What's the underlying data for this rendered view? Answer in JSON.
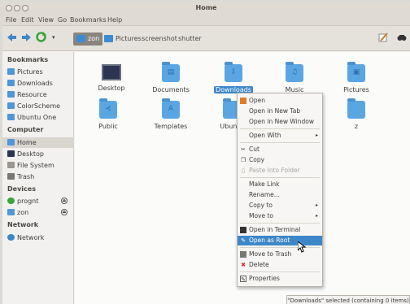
{
  "window": {
    "title": "Home"
  },
  "menubar": [
    "File",
    "Edit",
    "View",
    "Go",
    "Bookmarks",
    "Help"
  ],
  "breadcrumbs": [
    "zon",
    "Pictures",
    "screenshot",
    "shutter"
  ],
  "sidebar": {
    "bookmarks_head": "Bookmarks",
    "bookmarks": [
      "Pictures",
      "Downloads",
      "Resource",
      "ColorScheme",
      "Ubuntu One"
    ],
    "computer_head": "Computer",
    "computer": [
      "Home",
      "Desktop",
      "File System",
      "Trash"
    ],
    "devices_head": "Devices",
    "devices": [
      "prognt",
      "zon"
    ],
    "network_head": "Network",
    "network": [
      "Network"
    ]
  },
  "files": [
    {
      "name": "Desktop",
      "icon": "desktop-icon"
    },
    {
      "name": "Documents",
      "icon": "documents-folder-icon"
    },
    {
      "name": "Downloads",
      "icon": "downloads-folder-icon"
    },
    {
      "name": "Music",
      "icon": "music-folder-icon"
    },
    {
      "name": "Pictures",
      "icon": "pictures-folder-icon"
    },
    {
      "name": "Public",
      "icon": "public-folder-icon"
    },
    {
      "name": "Templates",
      "icon": "templates-folder-icon"
    },
    {
      "name": "Ubuntu",
      "icon": "ubuntu-folder-icon"
    },
    {
      "name": "z",
      "icon": "folder-icon"
    }
  ],
  "context_menu": {
    "open": "Open",
    "open_tab": "Open in New Tab",
    "open_window": "Open in New Window",
    "open_with": "Open With",
    "cut": "Cut",
    "copy": "Copy",
    "paste_into": "Paste Into Folder",
    "make_link": "Make Link",
    "rename": "Rename...",
    "copy_to": "Copy to",
    "move_to": "Move to",
    "open_terminal": "Open in Terminal",
    "open_root": "Open as Root",
    "move_trash": "Move to Trash",
    "delete": "Delete",
    "properties": "Properties"
  },
  "status": "\"Downloads\" selected (containing 0 items)",
  "colors": {
    "accent": "#3d87c9",
    "folder": "#5aa6e3"
  }
}
